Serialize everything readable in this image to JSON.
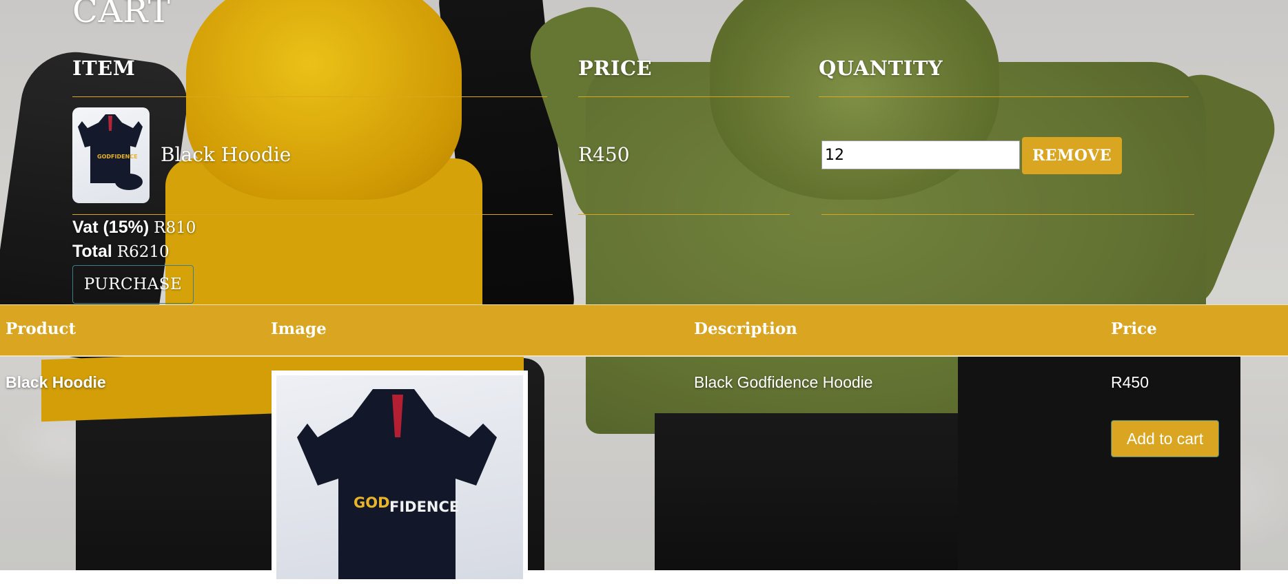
{
  "cart": {
    "title": "CART",
    "columns": {
      "item": "ITEM",
      "price": "PRICE",
      "quantity": "QUANTITY"
    },
    "items": [
      {
        "name": "Black Hoodie",
        "price": "R450",
        "quantity": "12",
        "remove_label": "REMOVE"
      }
    ],
    "vat_label": "Vat (15%)",
    "vat_value": "R810",
    "total_label": "Total",
    "total_value": "R6210",
    "purchase_label": "PURCHASE"
  },
  "products": {
    "headers": [
      "Product",
      "Image",
      "Description",
      "Price"
    ],
    "rows": [
      {
        "product": "Black Hoodie",
        "description": "Black Godfidence Hoodie",
        "price": "R450",
        "add_label": "Add to cart"
      }
    ]
  },
  "colors": {
    "accent": "#daa520",
    "button_border": "#3c7d8a"
  },
  "icons": {
    "cart_thumb": "hoodie-photo",
    "product_image": "hoodie-photo"
  }
}
